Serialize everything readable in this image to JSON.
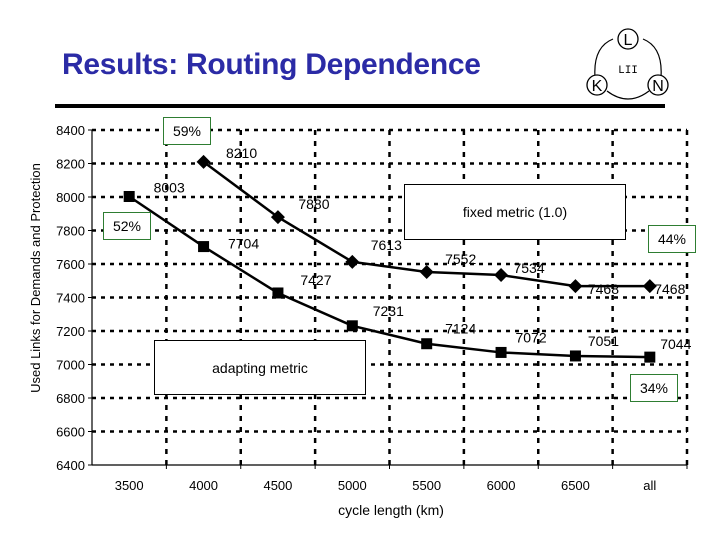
{
  "header": {
    "title": "Results: Routing Dependence",
    "logo": {
      "icon": "lkn-network-logo-icon",
      "nodes": [
        "L",
        "K",
        "N"
      ],
      "center_glyph": "LII"
    }
  },
  "colors": {
    "title": "#2b2ba6",
    "annotation_border": "#2e7d32",
    "series": "#000000"
  },
  "chart_data": {
    "type": "line",
    "title": "",
    "xlabel": "cycle length (km)",
    "ylabel": "Used Links for Demands and Protection",
    "categories": [
      "3500",
      "4000",
      "4500",
      "5000",
      "5500",
      "6000",
      "6500",
      "all"
    ],
    "ylim": [
      6400,
      8400
    ],
    "yticks": [
      6400,
      6600,
      6800,
      7000,
      7200,
      7400,
      7600,
      7800,
      8000,
      8200,
      8400
    ],
    "grid": true,
    "series": [
      {
        "name": "fixed metric (1.0)",
        "marker": "diamond",
        "values": [
          null,
          8210,
          7880,
          7613,
          7552,
          7534,
          7468,
          7468
        ]
      },
      {
        "name": "adapting metric",
        "marker": "square",
        "values": [
          8003,
          7704,
          7427,
          7231,
          7124,
          7072,
          7051,
          7044
        ]
      }
    ],
    "annotations": [
      {
        "text": "59%",
        "near": "top, above 4000 point of fixed metric"
      },
      {
        "text": "52%",
        "near": "left, beside 3500 point of adapting metric"
      },
      {
        "text": "44%",
        "near": "right, above last point of fixed metric"
      },
      {
        "text": "34%",
        "near": "right, below last point of adapting metric"
      }
    ],
    "legend": [
      {
        "text": "fixed metric (1.0)",
        "placement": "upper-right"
      },
      {
        "text": "adapting metric",
        "placement": "lower-left"
      }
    ]
  }
}
